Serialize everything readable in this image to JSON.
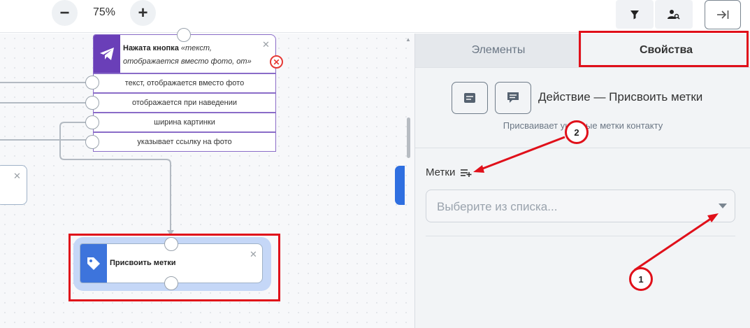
{
  "toolbar": {
    "zoom_out_label": "−",
    "zoom_level": "75%",
    "zoom_in_label": "+",
    "filter_icon": "filter-icon",
    "user_search_icon": "user-search-icon",
    "collapse_icon": "collapse-panel-icon"
  },
  "canvas": {
    "button_node": {
      "icon": "telegram-send-icon",
      "title": "Нажата кнопка",
      "subtitle": "«текст, отображается вместо фото, от»",
      "rows": [
        "текст, отображается вместо фото",
        "отображается при наведении",
        "ширина картинки",
        "указывает ссылку на фото"
      ]
    },
    "assign_node": {
      "icon": "tag-icon",
      "label": "Присвоить метки"
    }
  },
  "panel": {
    "tabs": [
      {
        "label": "Элементы",
        "active": false
      },
      {
        "label": "Свойства",
        "active": true
      }
    ],
    "action_title": "Действие — Присвоить метки",
    "action_description": "Присваивает ука… ые метки контакту",
    "tags_label": "Метки",
    "tags_select_placeholder": "Выберите из списка..."
  },
  "annotations": {
    "marker_1": "1",
    "marker_2": "2",
    "highlight_color": "#e0101a"
  },
  "colors": {
    "button_node_accent": "#6a3fb8",
    "assign_node_accent": "#3d74dc",
    "selection_glow": "#c5d7f7"
  }
}
